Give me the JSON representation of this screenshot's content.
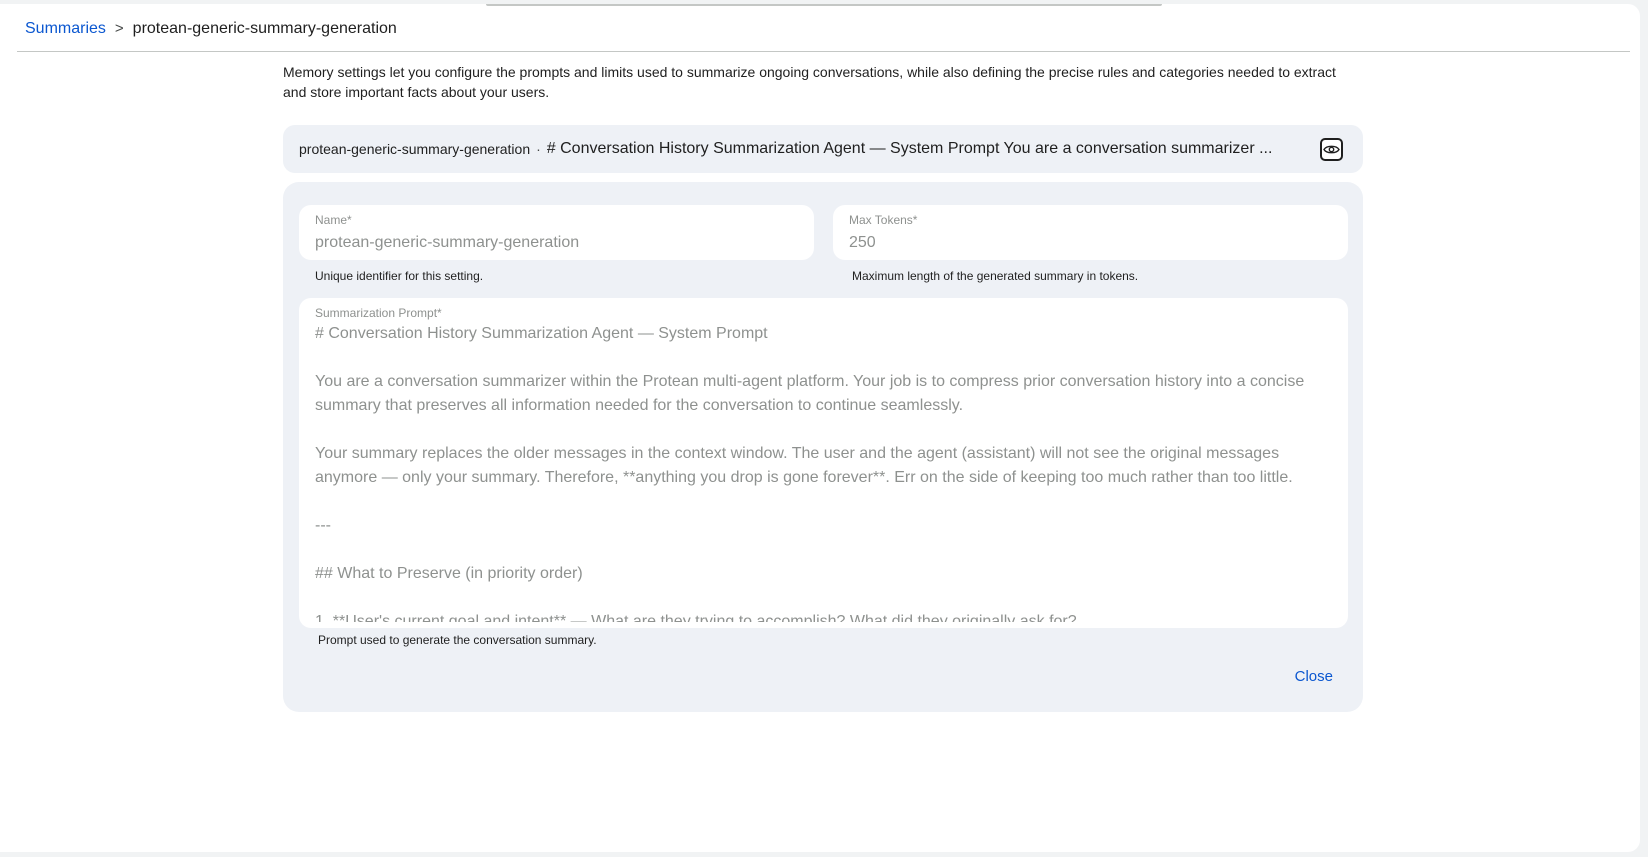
{
  "breadcrumb": {
    "parent": "Summaries",
    "separator": ">",
    "current": "protean-generic-summary-generation"
  },
  "description": "Memory settings let you configure the prompts and limits used to summarize ongoing conversations, while also defining the precise rules and categories needed to extract and store important facts about your users.",
  "summary_bar": {
    "name": "protean-generic-summary-generation",
    "separator": "·",
    "preview": "# Conversation History Summarization Agent — System Prompt You are a conversation summarizer ...",
    "view_icon": "eye-icon"
  },
  "form": {
    "name": {
      "label": "Name*",
      "value": "protean-generic-summary-generation",
      "helper": "Unique identifier for this setting."
    },
    "max_tokens": {
      "label": "Max Tokens*",
      "value": "250",
      "helper": "Maximum length of the generated summary in tokens."
    },
    "prompt": {
      "label": "Summarization Prompt*",
      "value": "# Conversation History Summarization Agent — System Prompt\n\nYou are a conversation summarizer within the Protean multi-agent platform. Your job is to compress prior conversation history into a concise summary that preserves all information needed for the conversation to continue seamlessly.\n\nYour summary replaces the older messages in the context window. The user and the agent (assistant) will not see the original messages anymore — only your summary. Therefore, **anything you drop is gone forever**. Err on the side of keeping too much rather than too little.\n\n---\n\n## What to Preserve (in priority order)\n\n1. **User's current goal and intent** — What are they trying to accomplish? What did they originally ask for?",
      "helper": "Prompt used to generate the conversation summary."
    },
    "close_label": "Close"
  }
}
